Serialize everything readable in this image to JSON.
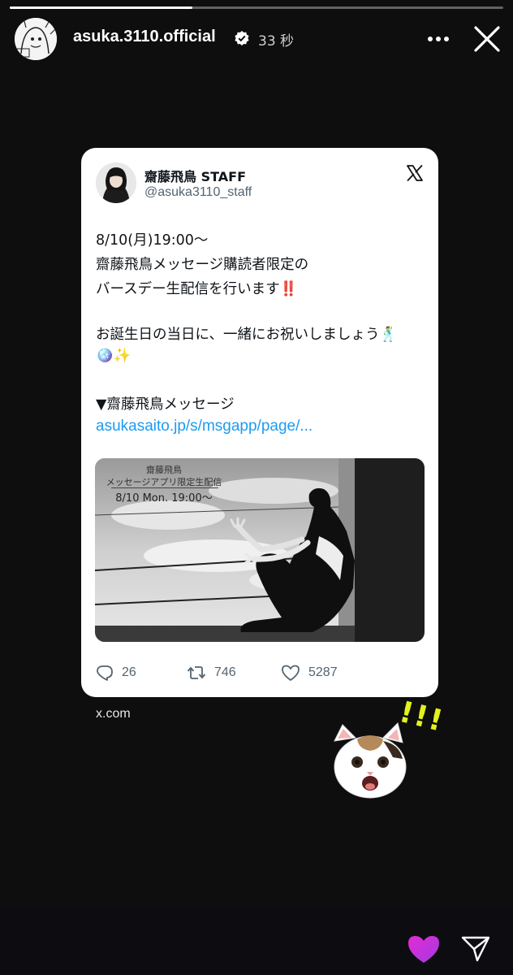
{
  "story": {
    "username": "asuka.3110.official",
    "time": "33 秒",
    "progress": 0.37,
    "source_label": "x.com"
  },
  "tweet": {
    "name": "齋藤飛鳥 STAFF",
    "handle": "@asuka3110_staff",
    "lines": [
      "8/10(月)19:00〜",
      "齋藤飛鳥メッセージ購読者限定の",
      "バースデー生配信を行います‼️",
      "",
      "お誕生日の当日に、一緒にお祝いしましょう🕺",
      "🪩✨",
      "",
      "▼齋藤飛鳥メッセージ"
    ],
    "link": "asukasaito.jp/s/msgapp/page/...",
    "media_caption": {
      "line1": "齋藤飛鳥",
      "line2": "メッセージアプリ限定生配信",
      "line3": "8/10 Mon. 19:00〜"
    },
    "replies": "26",
    "retweets": "746",
    "likes": "5287"
  },
  "sticker": {
    "exclaim": "!!!"
  },
  "colors": {
    "background": "#0e0e0e",
    "link": "#1d9bf0",
    "heart": "#c62fd8",
    "verified": "#ffffff"
  },
  "icons": [
    "avatar",
    "verified-icon",
    "more-icon",
    "close-icon",
    "x-logo-icon",
    "reply-icon",
    "retweet-icon",
    "like-icon",
    "heart-icon",
    "send-icon"
  ]
}
